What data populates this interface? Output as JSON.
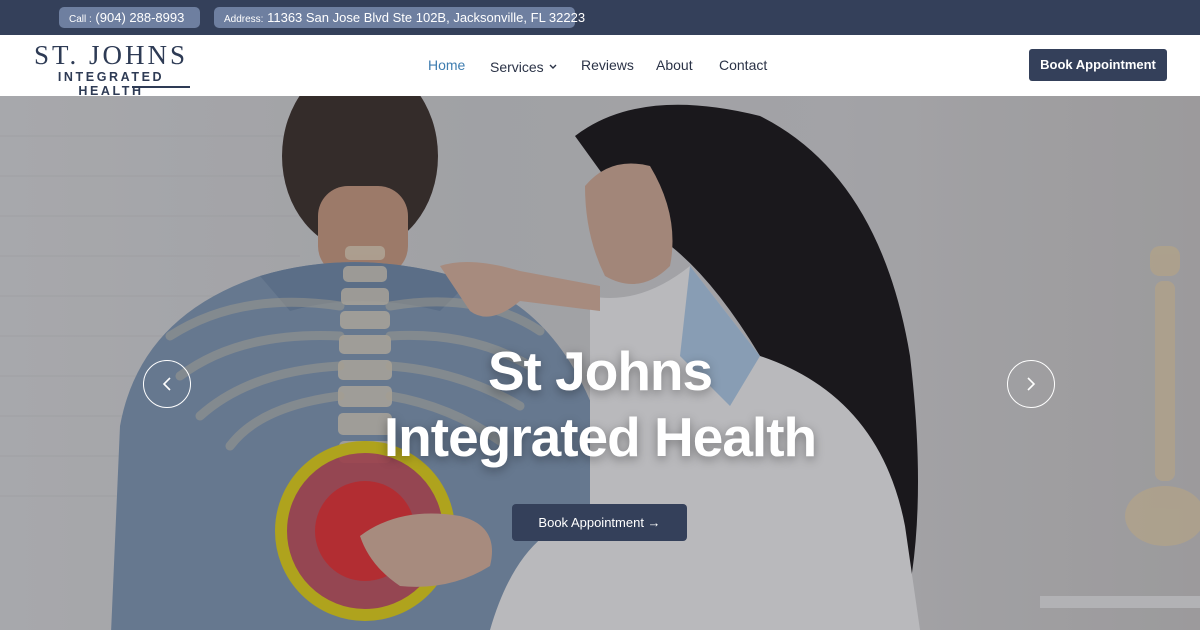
{
  "topbar": {
    "call_key": "Call :",
    "call_value": "(904) 288-8993",
    "address_key": "Address:",
    "address_value": "11363 San Jose Blvd Ste 102B, Jacksonville, FL 32223"
  },
  "logo": {
    "line1": "ST. JOHNS",
    "line2": "INTEGRATED HEALTH"
  },
  "nav": {
    "home": "Home",
    "services": "Services",
    "reviews": "Reviews",
    "about": "About",
    "contact": "Contact"
  },
  "header_cta": "Book Appointment",
  "hero": {
    "title_line1": "St Johns",
    "title_line2": "Integrated Health",
    "cta": "Book Appointment →"
  },
  "icons": {
    "prev": "chevron-left-icon",
    "next": "chevron-right-icon",
    "services_dropdown": "chevron-down-icon"
  },
  "colors": {
    "brand_navy": "#34405a",
    "accent_blue": "#3f7db0",
    "pill_blue": "#6e7fa0"
  }
}
